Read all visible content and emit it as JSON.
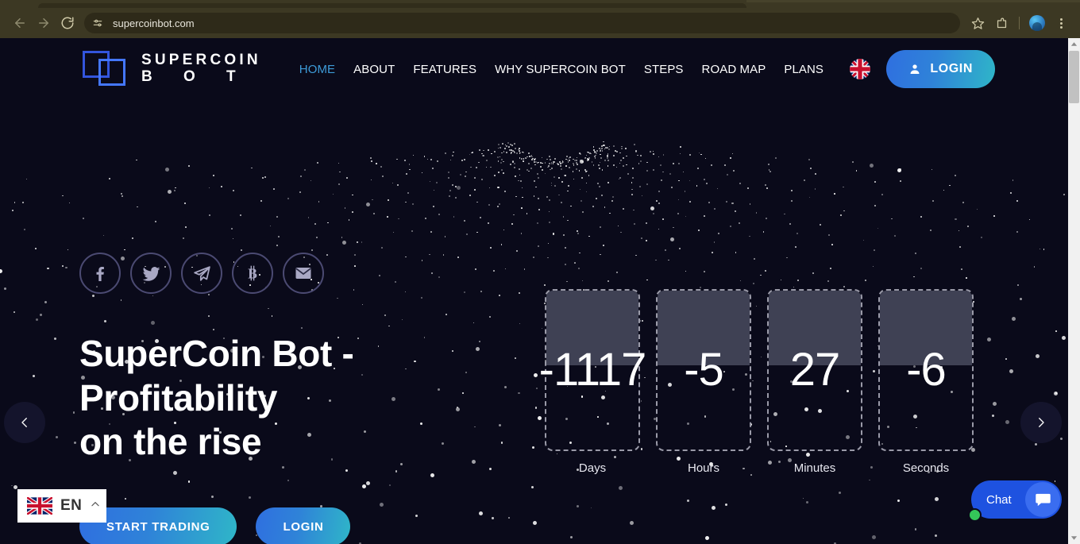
{
  "browser": {
    "url": "supercoinbot.com",
    "back_label": "Back",
    "forward_label": "Forward",
    "reload_label": "Reload",
    "site_info_label": "View site information",
    "bookmark_label": "Bookmark this tab",
    "extensions_label": "Extensions",
    "profile_label": "Profile",
    "menu_label": "Customize and control Google Chrome",
    "chrome_bg": "#3c3823"
  },
  "site": {
    "logo": {
      "line1": "SUPERCOIN",
      "line2": "B O T"
    },
    "nav": [
      {
        "label": "HOME",
        "active": true
      },
      {
        "label": "ABOUT",
        "active": false
      },
      {
        "label": "FEATURES",
        "active": false
      },
      {
        "label": "WHY SUPERCOIN BOT",
        "active": false
      },
      {
        "label": "STEPS",
        "active": false
      },
      {
        "label": "ROAD MAP",
        "active": false
      },
      {
        "label": "PLANS",
        "active": false
      }
    ],
    "language_flag": "uk-flag-icon",
    "login_button": "LOGIN",
    "accent_blue": "#3d9bd8",
    "gradient_from": "#2f6fe0",
    "gradient_to": "#2fb6c8",
    "background": "#0a0a1a"
  },
  "hero": {
    "title": "SuperCoin Bot - Profitability on the rise",
    "title_line1": "SuperCoin Bot -",
    "title_line2": "Profitability",
    "title_line3": "on the rise",
    "socials": [
      {
        "name": "facebook-icon"
      },
      {
        "name": "twitter-icon"
      },
      {
        "name": "telegram-icon"
      },
      {
        "name": "bitcoin-icon"
      },
      {
        "name": "email-icon"
      }
    ],
    "cta_primary": "START TRADING",
    "cta_secondary": "LOGIN",
    "prev_label": "Previous slide",
    "next_label": "Next slide"
  },
  "countdown": [
    {
      "value": "-1117",
      "label": "Days"
    },
    {
      "value": "-5",
      "label": "Hours"
    },
    {
      "value": "27",
      "label": "Minutes"
    },
    {
      "value": "-6",
      "label": "Seconds"
    }
  ],
  "widgets": {
    "language": {
      "code": "EN",
      "flag": "uk-flag-icon",
      "chevron": "chevron-up-icon"
    },
    "chat": {
      "label": "Chat",
      "status": "online"
    }
  }
}
